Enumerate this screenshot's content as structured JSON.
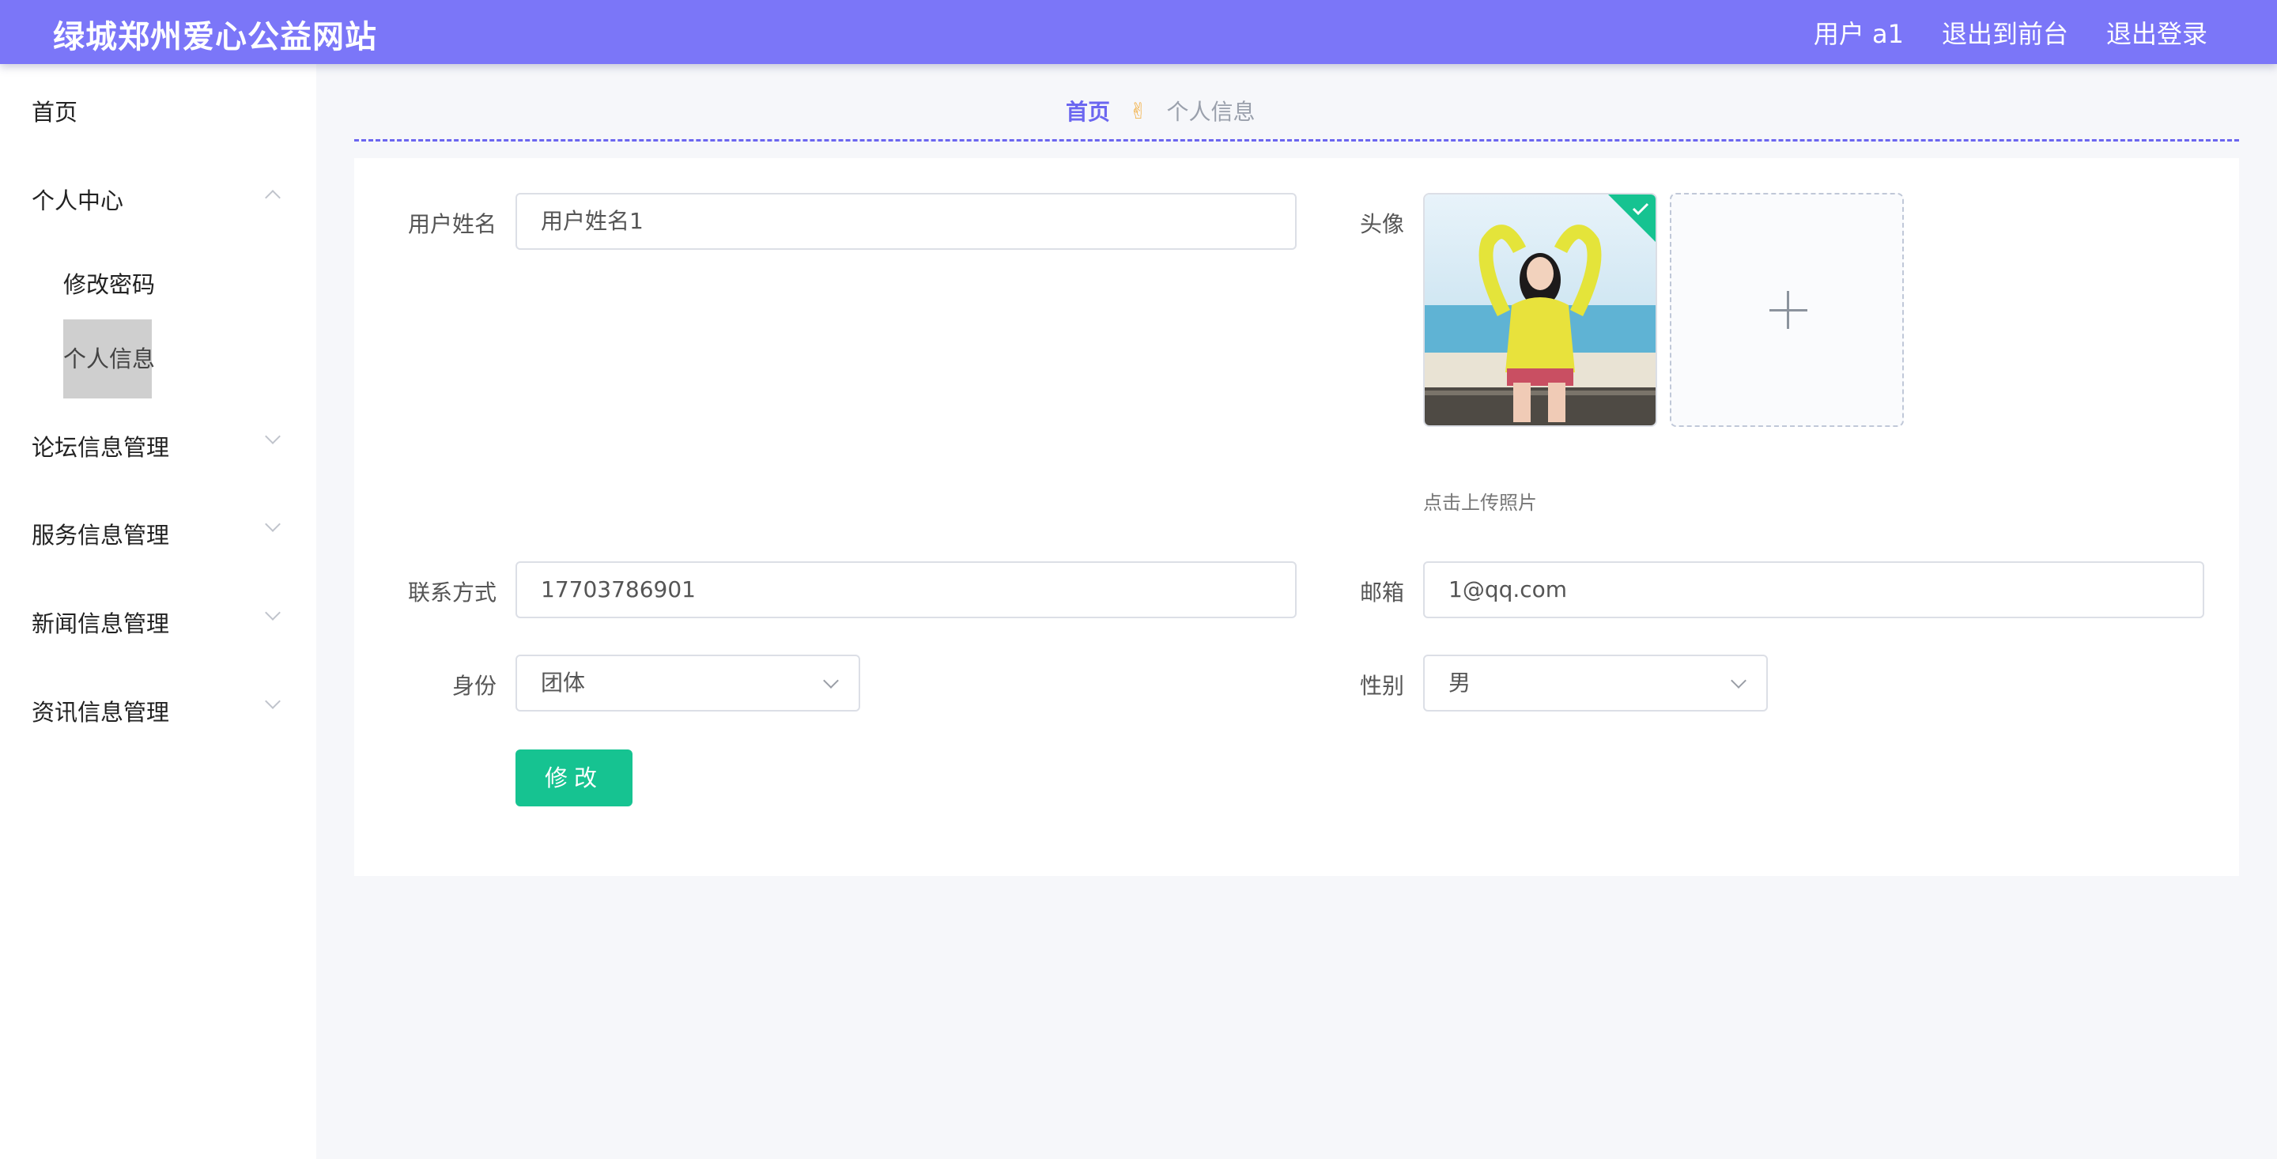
{
  "header": {
    "title": "绿城郑州爱心公益网站",
    "user": "用户 a1",
    "to_front": "退出到前台",
    "logout": "退出登录",
    "bg_color": "#7b76f8"
  },
  "sidebar": {
    "home": "首页",
    "personal_center": "个人中心",
    "change_password": "修改密码",
    "personal_info": "个人信息",
    "forum": "论坛信息管理",
    "service": "服务信息管理",
    "news": "新闻信息管理",
    "info": "资讯信息管理"
  },
  "breadcrumb": {
    "home": "首页",
    "separator_icon": "victory-hand-icon",
    "current": "个人信息"
  },
  "form": {
    "username_label": "用户姓名",
    "username_value": "用户姓名1",
    "avatar_label": "头像",
    "upload_hint": "点击上传照片",
    "contact_label": "联系方式",
    "contact_value": "17703786901",
    "email_label": "邮箱",
    "email_value": "1@qq.com",
    "identity_label": "身份",
    "identity_value": "团体",
    "gender_label": "性别",
    "gender_value": "男",
    "submit_label": "修改",
    "submit_color": "#16c391"
  }
}
